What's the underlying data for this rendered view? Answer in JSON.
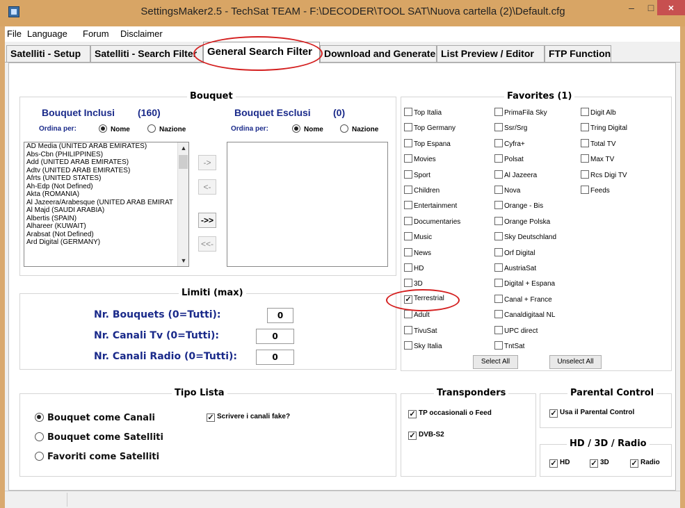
{
  "window": {
    "title": "SettingsMaker2.5 - TechSat TEAM - F:\\DECODER\\TOOL SAT\\Nuova cartella (2)\\Default.cfg",
    "min": "–",
    "max": "□",
    "close": "×"
  },
  "menu": [
    "File",
    "Language",
    "Forum",
    "Disclaimer"
  ],
  "tabs": [
    "Satelliti - Setup",
    "Satelliti - Search Filter",
    "General Search Filter",
    "Download and Generate",
    "List Preview / Editor",
    "FTP Function"
  ],
  "bouquet": {
    "title": "Bouquet",
    "inclusi_label": "Bouquet Inclusi",
    "inclusi_count": "(160)",
    "esclusi_label": "Bouquet Esclusi",
    "esclusi_count": "(0)",
    "ordina_label": "Ordina per:",
    "opt_nome": "Nome",
    "opt_nazione": "Nazione",
    "items": [
      "AD Media (UNITED ARAB EMIRATES)",
      "Abs-Cbn (PHILIPPINES)",
      "Add (UNITED ARAB EMIRATES)",
      "Adtv (UNITED ARAB EMIRATES)",
      "Afrts (UNITED STATES)",
      "Ah-Edp (Not Defined)",
      "Akta (ROMANIA)",
      "Al Jazeera/Arabesque (UNITED ARAB EMIRAT",
      "Al Majd (SAUDI ARABIA)",
      "Albertis (SPAIN)",
      "Alhareer (KUWAIT)",
      "Arabsat (Not Defined)",
      "Ard Digital (GERMANY)"
    ],
    "btn_add": "->",
    "btn_remove": "<-",
    "btn_add_all": "->>",
    "btn_remove_all": "<<-"
  },
  "limiti": {
    "title": "Limiti (max)",
    "rows": [
      {
        "label": "Nr. Bouquets (0=Tutti):",
        "value": "0"
      },
      {
        "label": "Nr. Canali Tv (0=Tutti):",
        "value": "0"
      },
      {
        "label": "Nr. Canali Radio (0=Tutti):",
        "value": "0"
      }
    ]
  },
  "favorites": {
    "title": "Favorites (1)",
    "col1": [
      "Top Italia",
      "Top Germany",
      "Top Espana",
      "Movies",
      "Sport",
      "Children",
      "Entertainment",
      "Documentaries",
      "Music",
      "News",
      "HD",
      "3D",
      "Terrestrial",
      "Adult",
      "TivuSat",
      "Sky Italia"
    ],
    "col2": [
      "PrimaFila Sky",
      "Ssr/Srg",
      "Cyfra+",
      "Polsat",
      "Al Jazeera",
      "Nova",
      "Orange - Bis",
      "Orange Polska",
      "Sky Deutschland",
      "Orf Digital",
      "AustriaSat",
      "Digital + Espana",
      "Canal + France",
      "Canaldigitaal NL",
      "UPC direct",
      "TntSat"
    ],
    "col3": [
      "Digit Alb",
      "Tring Digital",
      "Total TV",
      "Max TV",
      "Rcs Digi TV",
      "Feeds"
    ],
    "select_all": "Select All",
    "unselect_all": "Unselect All"
  },
  "tipo_lista": {
    "title": "Tipo Lista",
    "options": [
      "Bouquet come Canali",
      "Bouquet come Satelliti",
      "Favoriti come Satelliti"
    ],
    "fake": "Scrivere i canali fake?"
  },
  "transponders": {
    "title": "Transponders",
    "tp": "TP occasionali o Feed",
    "dvbs2": "DVB-S2"
  },
  "parental": {
    "title": "Parental Control",
    "use": "Usa il Parental Control"
  },
  "hd3d": {
    "title": "HD / 3D / Radio",
    "hd": "HD",
    "d3": "3D",
    "radio": "Radio"
  },
  "colors": {
    "annotation": "#d42020",
    "label_blue": "#1a2a8a"
  }
}
